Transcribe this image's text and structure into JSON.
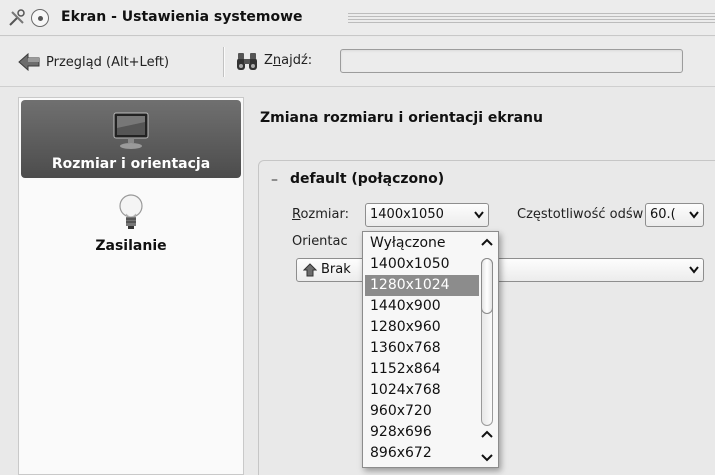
{
  "window": {
    "title": "Ekran - Ustawienia systemowe",
    "tools_icon": "tools-icon",
    "pin_icon": "pin-icon"
  },
  "toolbar": {
    "back_label": "Przegląd (Alt+Left)",
    "back_icon": "back-arrow-icon",
    "find_icon": "binoculars-icon",
    "find_label_prefix": "Z",
    "find_label_mnemonic": "n",
    "find_label_suffix": "ajdź:",
    "find_value": "",
    "find_placeholder": ""
  },
  "sidebar": {
    "items": [
      {
        "label": "Rozmiar i orientacja",
        "icon": "monitor-icon",
        "selected": true
      },
      {
        "label": "Zasilanie",
        "icon": "lightbulb-icon",
        "selected": false
      }
    ]
  },
  "main": {
    "title": "Zmiana rozmiaru i orientacji ekranu",
    "group": {
      "toggle": "–",
      "title": "default (połączono)",
      "size_label_mnemonic": "R",
      "size_label_rest": "ozmiar:",
      "size_value": "1400x1050",
      "rate_label": "Częstotliwość odśw",
      "rate_value": "60.(",
      "orientation_label": "Orientac",
      "orientation_value": "Brak",
      "orientation_icon": "up-arrow-icon"
    }
  },
  "popup": {
    "options": [
      "Wyłączone",
      "1400x1050",
      "1280x1024",
      "1440x900",
      "1280x960",
      "1360x768",
      "1152x864",
      "1024x768",
      "960x720",
      "928x696",
      "896x672"
    ],
    "highlighted_index": 2
  },
  "colors": {
    "selection": "#8c8c8c",
    "sidebar_selected": "#5a5a5a",
    "background": "#e9e9e9"
  }
}
